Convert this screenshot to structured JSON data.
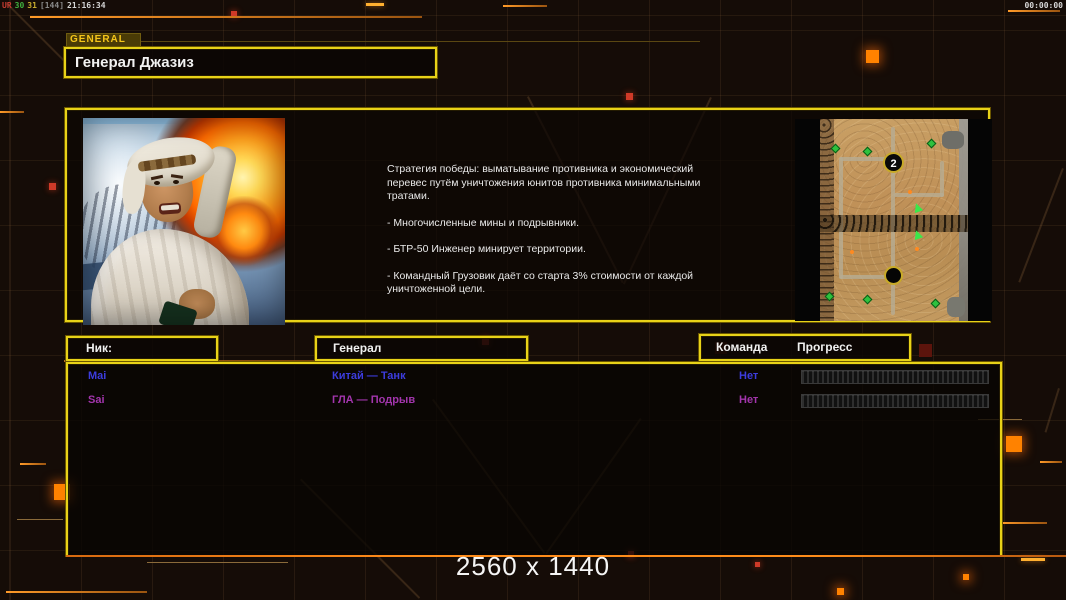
{
  "overlay": {
    "fps": [
      {
        "text": "UR",
        "color": "#c43b30"
      },
      {
        "text": "30",
        "color": "#3fae3f"
      },
      {
        "text": "31",
        "color": "#c7ab2e"
      },
      {
        "text": "[144]",
        "color": "#8a8a8a"
      },
      {
        "text": "21:16:34",
        "color": "#d6d6d6"
      }
    ],
    "timer": "00:00:00",
    "resolution": "2560 x 1440"
  },
  "header": {
    "tab": "GENERAL",
    "title": "Генерал Джазиз"
  },
  "briefing": {
    "paragraphs": [
      "Стратегия победы: выматывание противника и экономический перевес путём уничтожения юнитов противника минимальными тратами.",
      "- Многочисленные мины и подрывники.",
      "- БТР-50 Инженер минирует территории.",
      "- Командный Грузовик даёт со старта 3% стоимости от каждой уничтоженной цели."
    ],
    "minimap": {
      "badge": "2"
    }
  },
  "columns": {
    "nick": "Ник:",
    "general": "Генерал",
    "team": "Команда",
    "progress": "Прогресс"
  },
  "players": [
    {
      "nick": "Mai",
      "general": "Китай — Танк",
      "team": "Нет",
      "color": "#3c3cdd",
      "progress": 0
    },
    {
      "nick": "Sai",
      "general": "ГЛА — Подрыв",
      "team": "Нет",
      "color": "#a335ad",
      "progress": 0
    }
  ],
  "colors": {
    "panel_border": "#e8d218",
    "accent_orange": "#ff8200",
    "accent_red": "#cf3a28",
    "background": "#150c07"
  }
}
